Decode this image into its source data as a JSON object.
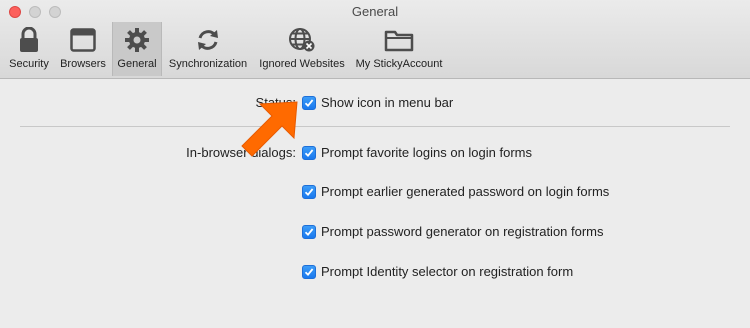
{
  "window": {
    "title": "General"
  },
  "toolbar": {
    "items": [
      {
        "label": "Security",
        "icon": "lock-icon"
      },
      {
        "label": "Browsers",
        "icon": "browser-window-icon"
      },
      {
        "label": "General",
        "icon": "gear-icon",
        "selected": true
      },
      {
        "label": "Synchronization",
        "icon": "sync-icon"
      },
      {
        "label": "Ignored Websites",
        "icon": "globe-blocked-icon"
      },
      {
        "label": "My StickyAccount",
        "icon": "folder-icon"
      }
    ]
  },
  "status": {
    "label": "Status:",
    "option": {
      "label": "Show icon in menu bar",
      "checked": true
    }
  },
  "in_browser": {
    "label": "In-browser dialogs:",
    "options": [
      {
        "label": "Prompt favorite logins on login forms",
        "checked": true
      },
      {
        "label": "Prompt earlier generated password on login forms",
        "checked": true
      },
      {
        "label": "Prompt password generator on registration forms",
        "checked": true
      },
      {
        "label": "Prompt Identity selector on registration form",
        "checked": true
      }
    ]
  },
  "colors": {
    "accent": "#1a78ee",
    "arrow": "#ff6a00",
    "close_light": "#fc605c"
  }
}
